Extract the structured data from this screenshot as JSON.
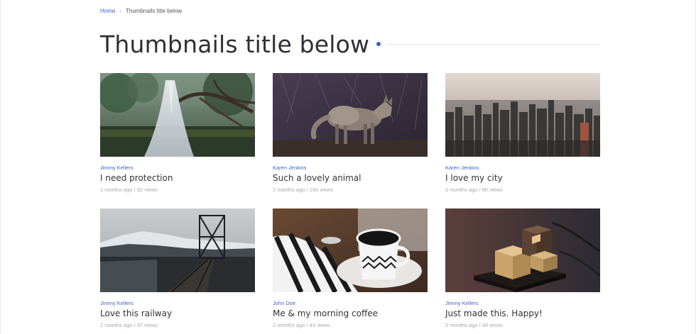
{
  "breadcrumb": {
    "home": "Home",
    "separator": "›",
    "current": "Thumbnails title below"
  },
  "header": {
    "title": "Thumbnails title below"
  },
  "colors": {
    "accent": "#3d63c6"
  },
  "cards": [
    {
      "author": "Jimmy Kellers",
      "title": "I need protection",
      "date": "2 months ago",
      "views": "92 views",
      "meta": "2 months ago / 92 views",
      "image": "forest-dress"
    },
    {
      "author": "Karen Jenkins",
      "title": "Such a lovely animal",
      "date": "2 months ago",
      "views": "193 views",
      "meta": "2 months ago / 193 views",
      "image": "coyote"
    },
    {
      "author": "Karen Jenkins",
      "title": "I love my city",
      "date": "2 months ago",
      "views": "80 views",
      "meta": "2 months ago / 80 views",
      "image": "city-skyline"
    },
    {
      "author": "Jimmy Kellers",
      "title": "Love this railway",
      "date": "2 months ago",
      "views": "37 views",
      "meta": "2 months ago / 37 views",
      "image": "railway-bridge"
    },
    {
      "author": "John Doe",
      "title": "Me & my morning coffee",
      "date": "2 months ago",
      "views": "43 views",
      "meta": "2 months ago / 43 views",
      "image": "coffee-cup"
    },
    {
      "author": "Jimmy Kellers",
      "title": "Just made this. Happy!",
      "date": "2 months ago",
      "views": "48 views",
      "meta": "2 months ago / 48 views",
      "image": "wooden-blocks"
    }
  ]
}
